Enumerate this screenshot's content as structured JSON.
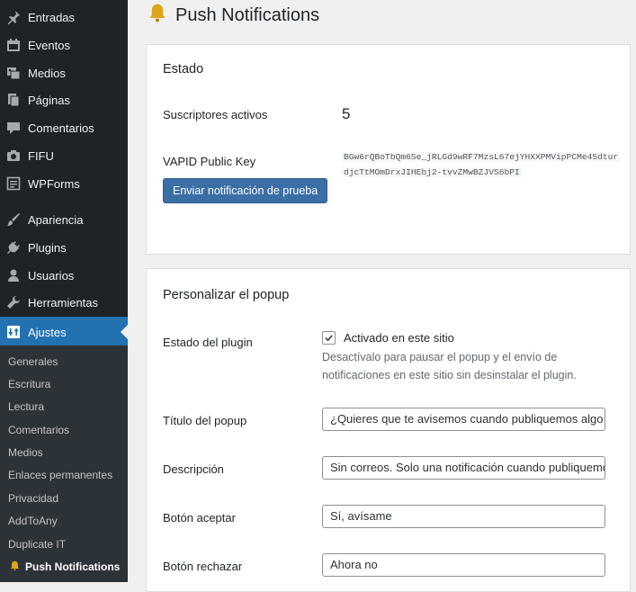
{
  "sidebar": {
    "items": [
      {
        "label": "Entradas",
        "icon": "pin-icon"
      },
      {
        "label": "Eventos",
        "icon": "calendar-icon"
      },
      {
        "label": "Medios",
        "icon": "media-icon"
      },
      {
        "label": "Páginas",
        "icon": "pages-icon"
      },
      {
        "label": "Comentarios",
        "icon": "comment-icon"
      },
      {
        "label": "FIFU",
        "icon": "camera-icon"
      },
      {
        "label": "WPForms",
        "icon": "forms-icon"
      },
      {
        "label": "Apariencia",
        "icon": "brush-icon"
      },
      {
        "label": "Plugins",
        "icon": "plugin-icon"
      },
      {
        "label": "Usuarios",
        "icon": "user-icon"
      },
      {
        "label": "Herramientas",
        "icon": "wrench-icon"
      },
      {
        "label": "Ajustes",
        "icon": "settings-icon"
      }
    ],
    "submenu": [
      "Generales",
      "Escritura",
      "Lectura",
      "Comentarios",
      "Medios",
      "Enlaces permanentes",
      "Privacidad",
      "AddToAny",
      "Duplicate IT",
      "Push Notifications"
    ]
  },
  "page": {
    "title": "Push Notifications"
  },
  "estado": {
    "heading": "Estado",
    "subs_label": "Suscriptores activos",
    "subs_value": "5",
    "vapid_label": "VAPID Public Key",
    "vapid_line1": "BGw6rQBoTbQm6Se_jRLGd9wRF7MzsL67ejYHXXPMVipPCMe45dtur",
    "vapid_line2": "djcTtMOmDrxJIHEbj2-tvvZMwBZJVS6bPI",
    "test_button": "Enviar notificación de prueba"
  },
  "popup": {
    "heading": "Personalizar el popup",
    "plugin_status_label": "Estado del plugin",
    "enabled_label": "Activado en este sitio",
    "enabled_desc": "Desactívalo para pausar el popup y el envío de notificaciones en este sitio sin desinstalar el plugin.",
    "title_label": "Título del popup",
    "title_value": "¿Quieres que te avisemos cuando publiquemos algo r",
    "desc_label": "Descripción",
    "desc_value": "Sin correos. Solo una notificación cuando publiquemo",
    "accept_label": "Botón aceptar",
    "accept_value": "Sí, avísame",
    "reject_label": "Botón rechazar",
    "reject_value": "Ahora no"
  },
  "colors": {
    "sidebar_bg": "#1d2327",
    "submenu_bg": "#2c3338",
    "accent": "#2271b1",
    "button_bg": "#3a6ea5",
    "bell": "#dba617"
  }
}
